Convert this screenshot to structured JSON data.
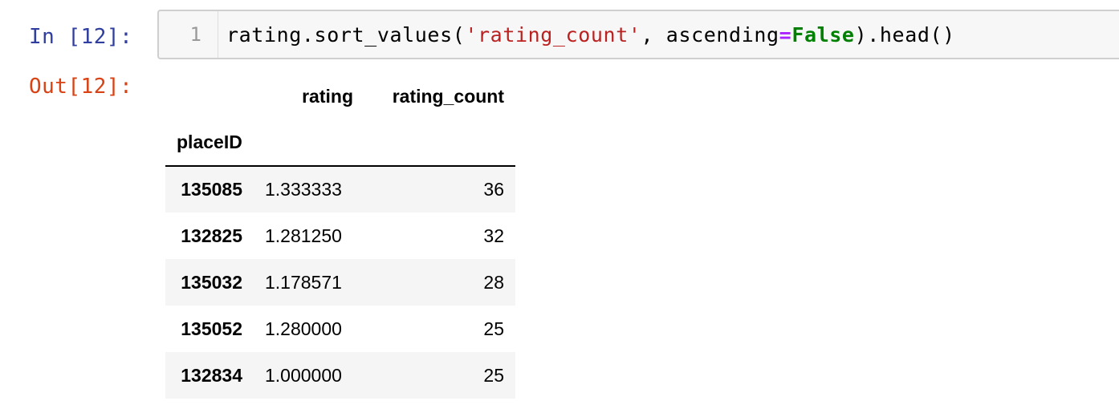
{
  "input_cell": {
    "prompt": "In [12]:",
    "line_number": "1",
    "code_tokens": [
      {
        "text": "rating.sort_values(",
        "style": "plain"
      },
      {
        "text": "'rating_count'",
        "style": "string"
      },
      {
        "text": ", ascending",
        "style": "plain"
      },
      {
        "text": "=",
        "style": "operator"
      },
      {
        "text": "False",
        "style": "keyword"
      },
      {
        "text": ").head()",
        "style": "plain"
      }
    ]
  },
  "output_cell": {
    "prompt": "Out[12]:",
    "table": {
      "columns": [
        "rating",
        "rating_count"
      ],
      "index_name": "placeID",
      "rows": [
        {
          "index": "135085",
          "rating": "1.333333",
          "rating_count": "36"
        },
        {
          "index": "132825",
          "rating": "1.281250",
          "rating_count": "32"
        },
        {
          "index": "135032",
          "rating": "1.178571",
          "rating_count": "28"
        },
        {
          "index": "135052",
          "rating": "1.280000",
          "rating_count": "25"
        },
        {
          "index": "132834",
          "rating": "1.000000",
          "rating_count": "25"
        }
      ]
    }
  },
  "colors": {
    "in_prompt": "#303f9f",
    "out_prompt": "#d84315",
    "string": "#ba2121",
    "operator": "#aa22ff",
    "keyword": "#008000",
    "cell_background": "#f7f7f7",
    "row_stripe": "#f5f5f5"
  }
}
